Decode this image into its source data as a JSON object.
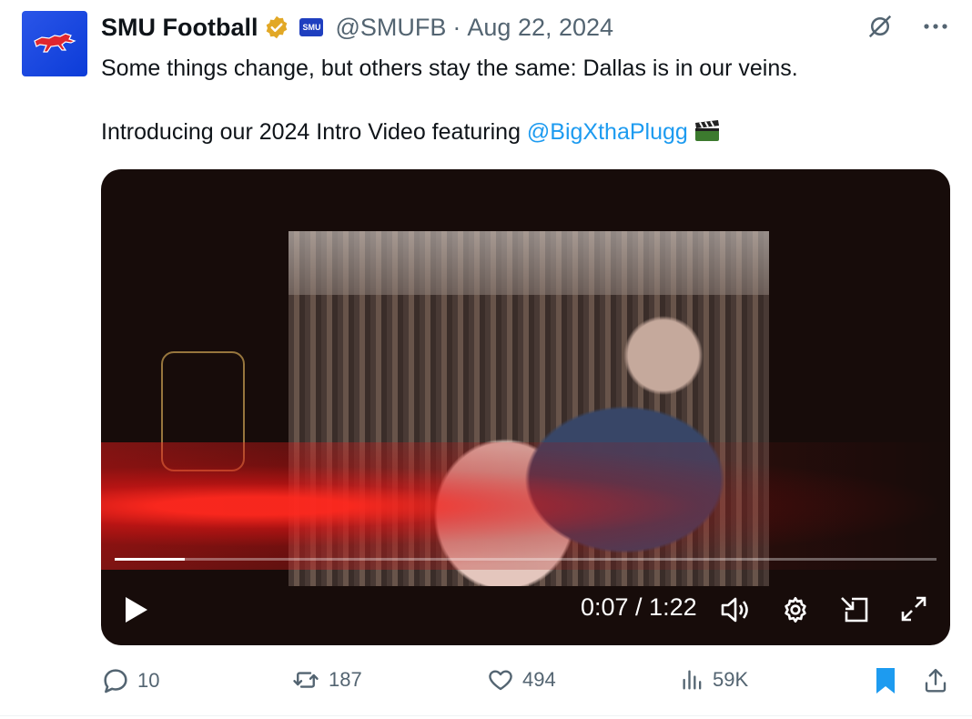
{
  "post": {
    "author": {
      "display_name": "SMU Football",
      "handle": "@SMUFB",
      "affiliate_badge_text": "SMU",
      "verified": true
    },
    "separator": "·",
    "date": "Aug 22, 2024",
    "text_line1": "Some things change, but others stay the same: Dallas is in our veins.",
    "text_line2_prefix": "Introducing our 2024 Intro Video featuring ",
    "mention": "@BigXthaPlugg",
    "emoji": "clapper-board-icon"
  },
  "video": {
    "current_time": "0:07",
    "duration": "1:22",
    "time_display": "0:07 / 1:22",
    "progress": 0.0854
  },
  "actions": {
    "replies": "10",
    "reposts": "187",
    "likes": "494",
    "views": "59K"
  },
  "colors": {
    "accent": "#1d9bf0",
    "muted": "#536471",
    "verified_gold": "#e2a826",
    "avatar_blue": "#1e46e3",
    "smu_red": "#e0262f"
  }
}
